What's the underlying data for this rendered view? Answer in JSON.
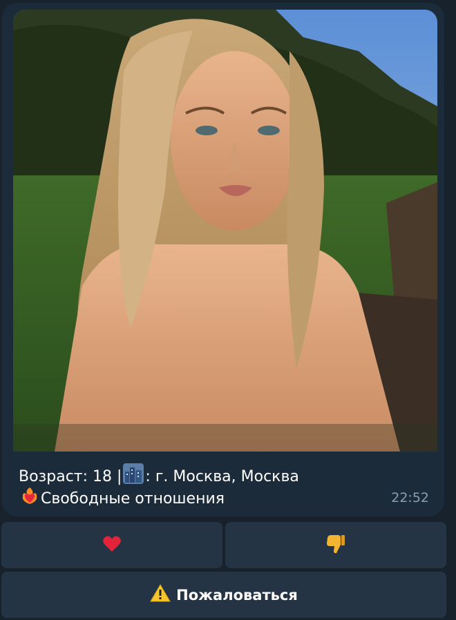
{
  "message": {
    "caption_age": "Возраст: 18 | ",
    "caption_city": ": г. Москва, Москва",
    "caption_status": "Свободные отношения",
    "time": "22:52",
    "city_icon": "cityscape-icon",
    "heart_fire_icon": "heart-on-fire-icon"
  },
  "buttons": {
    "like_label": "❤️",
    "dislike_label": "👎",
    "report_icon": "⚠️",
    "report_label": "Пожаловаться"
  }
}
